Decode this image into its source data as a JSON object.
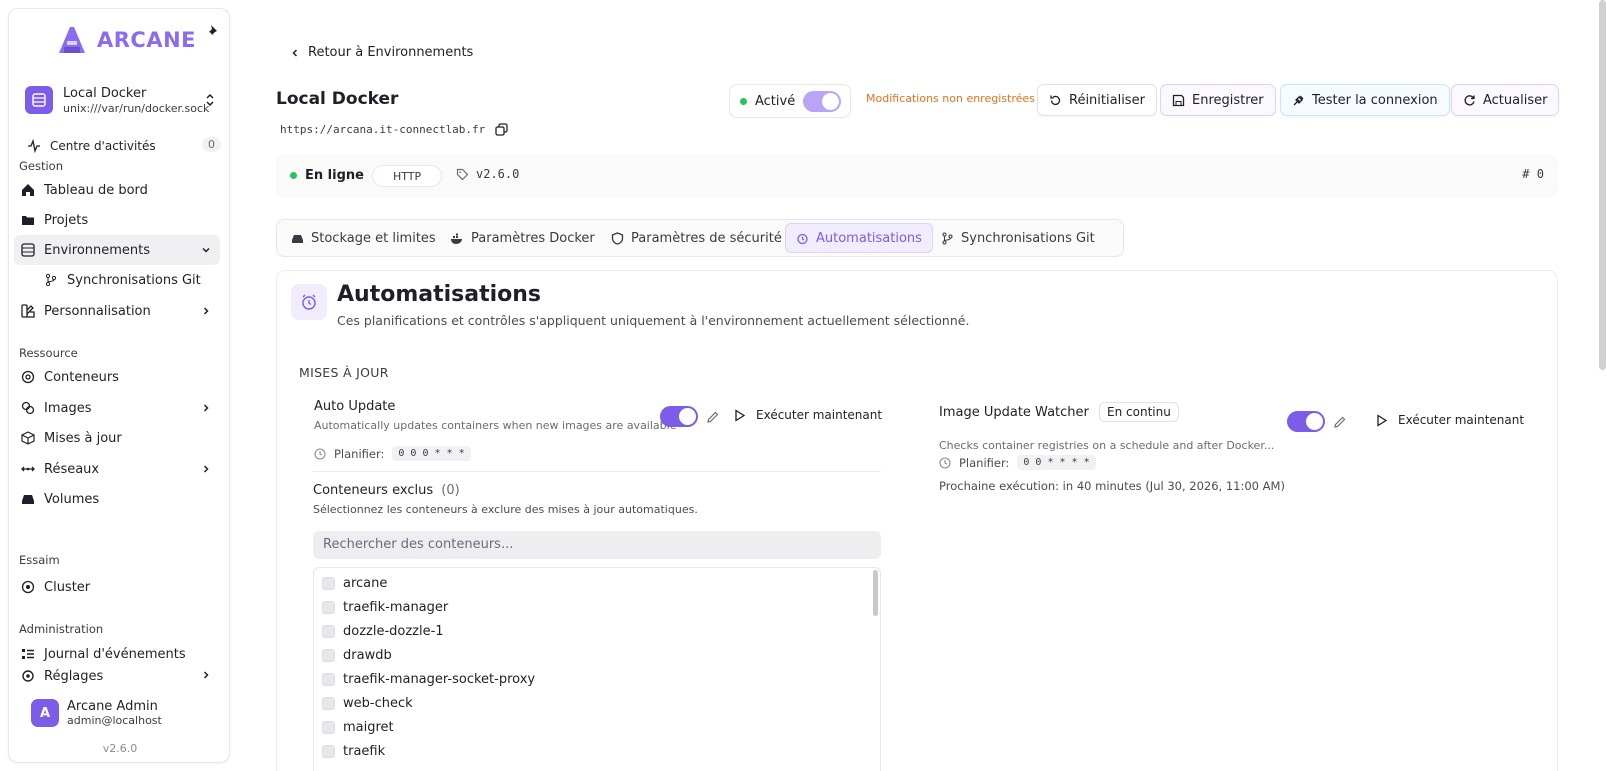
{
  "sidebar": {
    "brand": "ARCANE",
    "environment": {
      "name": "Local Docker",
      "socket": "unix:///var/run/docker.sock"
    },
    "activity": {
      "label": "Centre d'activités",
      "count": "0"
    },
    "groups": {
      "gestion": "Gestion",
      "ressource": "Ressource",
      "essaim": "Essaim",
      "administration": "Administration"
    },
    "items": {
      "dashboard": "Tableau de bord",
      "projects": "Projets",
      "environments": "Environnements",
      "git_sync": "Synchronisations Git",
      "customization": "Personnalisation",
      "containers": "Conteneurs",
      "images": "Images",
      "updates": "Mises à jour",
      "networks": "Réseaux",
      "volumes": "Volumes",
      "cluster": "Cluster",
      "events": "Journal d'événements",
      "settings": "Réglages"
    },
    "user": {
      "name": "Arcane Admin",
      "email": "admin@localhost",
      "initial": "A"
    },
    "version": "v2.6.0"
  },
  "header": {
    "back_label": "Retour à Environnements",
    "title": "Local Docker",
    "url": "https://arcana.it-connectlab.fr",
    "enabled_label": "Activé",
    "unsaved": "Modifications non enregistrées",
    "buttons": {
      "reset": "Réinitialiser",
      "save": "Enregistrer",
      "test": "Tester la connexion",
      "refresh": "Actualiser"
    }
  },
  "status": {
    "online": "En ligne",
    "protocol": "HTTP",
    "version": "v2.6.0",
    "id": "0"
  },
  "tabs": [
    "Stockage et limites",
    "Paramètres Docker",
    "Paramètres de sécurité",
    "Automatisations",
    "Synchronisations Git"
  ],
  "panel": {
    "title": "Automatisations",
    "subtitle": "Ces planifications et contrôles s'appliquent uniquement à l'environnement actuellement sélectionné.",
    "section": "MISES À JOUR",
    "auto_update": {
      "title": "Auto Update",
      "desc": "Automatically updates containers when new images are available",
      "schedule_label": "Planifier:",
      "cron": "0 0 0 * * *",
      "run": "Exécuter maintenant"
    },
    "watcher": {
      "title": "Image Update Watcher",
      "mode": "En continu",
      "desc": "Checks container registries on a schedule and after Docker...",
      "schedule_label": "Planifier:",
      "cron": "0 0 * * * *",
      "next_run": "Prochaine exécution: in 40 minutes (Jul 30, 2026, 11:00 AM)",
      "run": "Exécuter maintenant"
    },
    "excluded": {
      "title": "Conteneurs exclus",
      "count": "(0)",
      "desc": "Sélectionnez les conteneurs à exclure des mises à jour automatiques.",
      "search_placeholder": "Rechercher des conteneurs...",
      "containers": [
        "arcane",
        "traefik-manager",
        "dozzle-dozzle-1",
        "drawdb",
        "traefik-manager-socket-proxy",
        "web-check",
        "maigret",
        "traefik"
      ]
    }
  },
  "colors": {
    "accent": "#7c5ce8",
    "warning": "#e0721f",
    "online": "#22c55e"
  }
}
